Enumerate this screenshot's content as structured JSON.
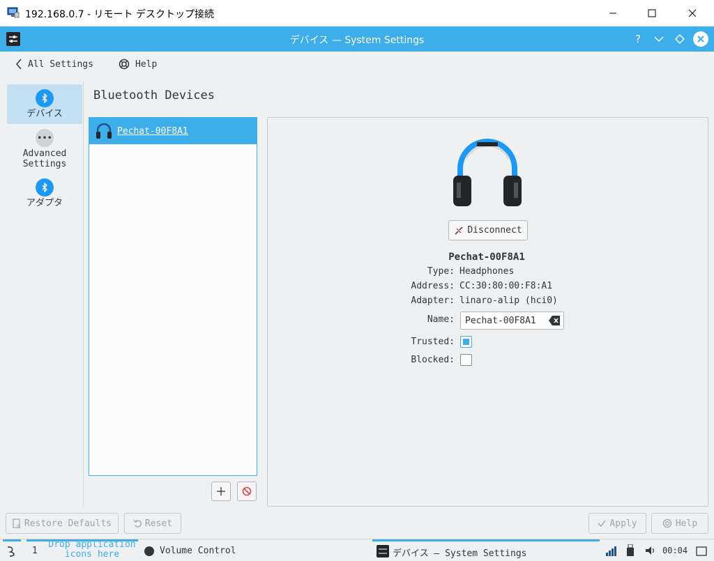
{
  "rdp": {
    "title": "192.168.0.7 - リモート デスクトップ接続"
  },
  "window": {
    "title": "デバイス — System Settings"
  },
  "toolbar": {
    "all_settings": "All Settings",
    "help": "Help"
  },
  "sidebar": {
    "items": [
      {
        "label": "デバイス",
        "icon": "bluetooth-icon"
      },
      {
        "label_line1": "Advanced",
        "label_line2": "Settings",
        "icon": "more-icon"
      },
      {
        "label": "アダプタ",
        "icon": "bluetooth-icon"
      }
    ]
  },
  "section": {
    "title": "Bluetooth Devices"
  },
  "devices": [
    {
      "name": "Pechat-00F8A1",
      "icon": "headphones-icon"
    }
  ],
  "details": {
    "disconnect_label": "Disconnect",
    "device_name": "Pechat-00F8A1",
    "type_label": "Type:",
    "type_value": "Headphones",
    "address_label": "Address:",
    "address_value": "CC:30:80:00:F8:A1",
    "adapter_label": "Adapter:",
    "adapter_value": "linaro-alip (hci0)",
    "name_label": "Name:",
    "name_value": "Pechat-00F8A1",
    "trusted_label": "Trusted:",
    "trusted": true,
    "blocked_label": "Blocked:",
    "blocked": false
  },
  "buttons": {
    "restore_defaults": "Restore Defaults",
    "reset": "Reset",
    "apply": "Apply",
    "help": "Help"
  },
  "taskbar": {
    "desktop_number": "1",
    "drop_line1": "Drop application",
    "drop_line2": "icons here",
    "volume": "Volume Control",
    "task": "デバイス  — System Settings",
    "clock": "00:04"
  },
  "colors": {
    "accent": "#3daee9",
    "bluetooth": "#1d99f3",
    "background": "#eff0f1"
  }
}
